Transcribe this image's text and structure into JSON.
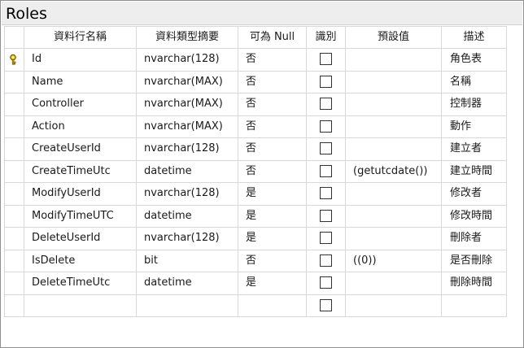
{
  "title": "Roles",
  "columns": {
    "name": "資料行名稱",
    "type": "資料類型摘要",
    "nullable": "可為 Null",
    "identity": "識別",
    "default": "預設值",
    "description": "描述"
  },
  "rows": [
    {
      "name": "Id",
      "type": "nvarchar(128)",
      "nullable": "否",
      "identity": false,
      "default": "",
      "description": "角色表",
      "primary_key": true
    },
    {
      "name": "Name",
      "type": "nvarchar(MAX)",
      "nullable": "否",
      "identity": false,
      "default": "",
      "description": "名稱",
      "primary_key": false
    },
    {
      "name": "Controller",
      "type": "nvarchar(MAX)",
      "nullable": "否",
      "identity": false,
      "default": "",
      "description": "控制器",
      "primary_key": false
    },
    {
      "name": "Action",
      "type": "nvarchar(MAX)",
      "nullable": "否",
      "identity": false,
      "default": "",
      "description": "動作",
      "primary_key": false
    },
    {
      "name": "CreateUserId",
      "type": "nvarchar(128)",
      "nullable": "否",
      "identity": false,
      "default": "",
      "description": "建立者",
      "primary_key": false
    },
    {
      "name": "CreateTimeUtc",
      "type": "datetime",
      "nullable": "否",
      "identity": false,
      "default": "(getutcdate())",
      "description": "建立時間",
      "primary_key": false
    },
    {
      "name": "ModifyUserId",
      "type": "nvarchar(128)",
      "nullable": "是",
      "identity": false,
      "default": "",
      "description": "修改者",
      "primary_key": false
    },
    {
      "name": "ModifyTimeUTC",
      "type": "datetime",
      "nullable": "是",
      "identity": false,
      "default": "",
      "description": "修改時間",
      "primary_key": false
    },
    {
      "name": "DeleteUserId",
      "type": "nvarchar(128)",
      "nullable": "是",
      "identity": false,
      "default": "",
      "description": "刪除者",
      "primary_key": false
    },
    {
      "name": "IsDelete",
      "type": "bit",
      "nullable": "否",
      "identity": false,
      "default": "((0))",
      "description": "是否刪除",
      "primary_key": false
    },
    {
      "name": "DeleteTimeUtc",
      "type": "datetime",
      "nullable": "是",
      "identity": false,
      "default": "",
      "description": "刪除時間",
      "primary_key": false
    }
  ],
  "colors": {
    "key_icon": "#f5c400",
    "grid_line": "#d8d8d8",
    "title_bar": "#eeeeee"
  }
}
